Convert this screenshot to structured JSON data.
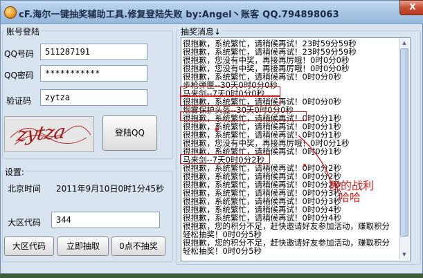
{
  "window": {
    "title": "cF.海尔一键抽奖辅助工具.修复登陆失败 by:Angel丶账客 QQ.794898063",
    "close_label": "X"
  },
  "login": {
    "group_title": "账号登陆",
    "qq_label": "QQ号码",
    "qq_value": "511287191",
    "pwd_label": "QQ密码",
    "pwd_value": "***********",
    "code_label": "验证码",
    "code_value": "zytza",
    "captcha_text": "zytza",
    "login_button": "登陆QQ"
  },
  "settings": {
    "group_title": "设置:",
    "time_label": "北京时间",
    "time_value": "2011年9月10日0时1分45秒",
    "region_label": "大区代码",
    "region_value": "344",
    "btn_region": "大区代码",
    "btn_draw": "立即抽取",
    "btn_stop": "0点不抽奖"
  },
  "log": {
    "group_title": "抽奖消息↓",
    "lines": [
      "很抱歉，系统繁忙，请稍候再试！23时59分59秒",
      "很抱歉，系统繁忙，请稍候再试！23时59分59秒",
      "很抱歉，您没有中奖，再接再厉哦！0时0分0秒",
      "很抱歉，您没有中奖，再接再厉哦！0时0分0秒",
      "很抱歉，系统繁忙，请稍候再试！0时0分0秒",
      "步枪弹匣--30天0时0分0秒",
      "马来剑--7天0时0分0秒",
      "很抱歉，系统繁忙，请稍候再试！0时0分0秒",
      "烟雾保护头盔--30天0时0分0秒",
      "很抱歉，系统繁忙，请稍候再试！0时0分1秒",
      "很抱歉，系统繁忙，请稍候再试！0时0分1秒",
      "很抱歉，系统繁忙，请稍候再试！0时0分1秒",
      "很抱歉，您没有中奖，再接再厉哦！0时0分1秒",
      "很抱歉，系统繁忙，请稍候再试！0时0分1秒",
      "马来剑--7天0时0分2秒",
      "很抱歉，系统繁忙，请稍候再试！0时0分2秒",
      "很抱歉，系统繁忙，请稍候再试！0时0分2秒",
      "很抱歉，系统繁忙，请稍候再试！0时0分2秒",
      "很抱歉，系统繁忙，请稍候再试！0时0分3秒",
      "很抱歉，系统繁忙，请稍候再试！0时0分3秒",
      "很抱歉，系统繁忙，请稍候再试！0时0分4秒",
      "很抱歉，系统繁忙，请稍候再试！0时0分4秒",
      "很抱歉，您的积分不足，赶快邀请好友参加活动，赚取积分",
      "轻松抽奖！0时0分5秒",
      "很抱歉，您的积分不足，赶快邀请好友参加活动，赚取积分",
      "轻松抽奖！0时0分5秒"
    ]
  },
  "annotation": {
    "line1": "晚的战利",
    "line2": "哈哈"
  },
  "colors": {
    "annotation_red": "#d41c1c",
    "window_bg": "#d8e5f1"
  }
}
